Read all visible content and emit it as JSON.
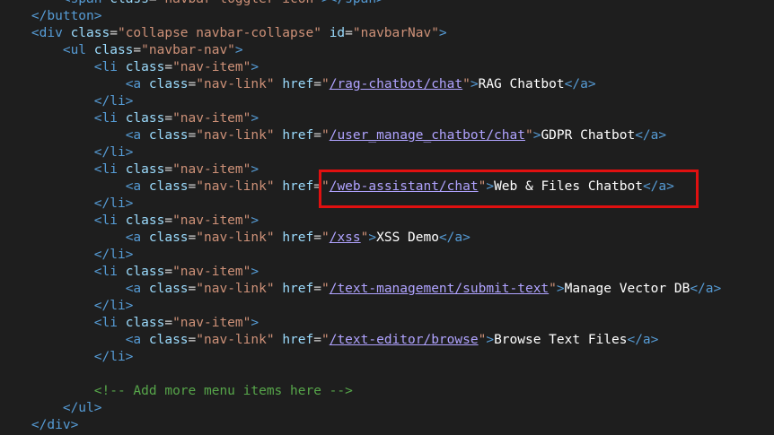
{
  "editor": {
    "highlight_color": "#e01010",
    "colors": {
      "tag": "#569cd6",
      "attr": "#9cdcfe",
      "value": "#ce9178",
      "link": "#b0a3ff",
      "comment": "#57a64a",
      "background": "#1e1e1e"
    },
    "lines": [
      {
        "indent": 8,
        "tokens": [
          {
            "t": "tag",
            "v": "<span "
          },
          {
            "t": "attr",
            "v": "class"
          },
          {
            "t": "punct",
            "v": "="
          },
          {
            "t": "val",
            "v": "\"navbar-toggler-icon\""
          },
          {
            "t": "tag",
            "v": "></span>"
          }
        ]
      },
      {
        "indent": 4,
        "tokens": [
          {
            "t": "tag",
            "v": "</button>"
          }
        ]
      },
      {
        "indent": 4,
        "tokens": [
          {
            "t": "tag",
            "v": "<div "
          },
          {
            "t": "attr",
            "v": "class"
          },
          {
            "t": "punct",
            "v": "="
          },
          {
            "t": "val",
            "v": "\"collapse navbar-collapse\""
          },
          {
            "t": "punct",
            "v": " "
          },
          {
            "t": "attr",
            "v": "id"
          },
          {
            "t": "punct",
            "v": "="
          },
          {
            "t": "val",
            "v": "\"navbarNav\""
          },
          {
            "t": "tag",
            "v": ">"
          }
        ]
      },
      {
        "indent": 8,
        "tokens": [
          {
            "t": "tag",
            "v": "<ul "
          },
          {
            "t": "attr",
            "v": "class"
          },
          {
            "t": "punct",
            "v": "="
          },
          {
            "t": "val",
            "v": "\"navbar-nav\""
          },
          {
            "t": "tag",
            "v": ">"
          }
        ]
      },
      {
        "indent": 12,
        "tokens": [
          {
            "t": "tag",
            "v": "<li "
          },
          {
            "t": "attr",
            "v": "class"
          },
          {
            "t": "punct",
            "v": "="
          },
          {
            "t": "val",
            "v": "\"nav-item\""
          },
          {
            "t": "tag",
            "v": ">"
          }
        ]
      },
      {
        "indent": 16,
        "tokens": [
          {
            "t": "tag",
            "v": "<a "
          },
          {
            "t": "attr",
            "v": "class"
          },
          {
            "t": "punct",
            "v": "="
          },
          {
            "t": "val",
            "v": "\"nav-link\""
          },
          {
            "t": "punct",
            "v": " "
          },
          {
            "t": "attr",
            "v": "href"
          },
          {
            "t": "punct",
            "v": "="
          },
          {
            "t": "val",
            "v": "\""
          },
          {
            "t": "link",
            "v": "/rag-chatbot/chat"
          },
          {
            "t": "val",
            "v": "\""
          },
          {
            "t": "tag",
            "v": ">"
          },
          {
            "t": "text",
            "v": "RAG Chatbot"
          },
          {
            "t": "tag",
            "v": "</a>"
          }
        ]
      },
      {
        "indent": 12,
        "tokens": [
          {
            "t": "tag",
            "v": "</li>"
          }
        ]
      },
      {
        "indent": 12,
        "tokens": [
          {
            "t": "tag",
            "v": "<li "
          },
          {
            "t": "attr",
            "v": "class"
          },
          {
            "t": "punct",
            "v": "="
          },
          {
            "t": "val",
            "v": "\"nav-item\""
          },
          {
            "t": "tag",
            "v": ">"
          }
        ]
      },
      {
        "indent": 16,
        "tokens": [
          {
            "t": "tag",
            "v": "<a "
          },
          {
            "t": "attr",
            "v": "class"
          },
          {
            "t": "punct",
            "v": "="
          },
          {
            "t": "val",
            "v": "\"nav-link\""
          },
          {
            "t": "punct",
            "v": " "
          },
          {
            "t": "attr",
            "v": "href"
          },
          {
            "t": "punct",
            "v": "="
          },
          {
            "t": "val",
            "v": "\""
          },
          {
            "t": "link",
            "v": "/user_manage_chatbot/chat"
          },
          {
            "t": "val",
            "v": "\""
          },
          {
            "t": "tag",
            "v": ">"
          },
          {
            "t": "text",
            "v": "GDPR Chatbot"
          },
          {
            "t": "tag",
            "v": "</a>"
          }
        ]
      },
      {
        "indent": 12,
        "tokens": [
          {
            "t": "tag",
            "v": "</li>"
          }
        ]
      },
      {
        "indent": 12,
        "tokens": [
          {
            "t": "tag",
            "v": "<li "
          },
          {
            "t": "attr",
            "v": "class"
          },
          {
            "t": "punct",
            "v": "="
          },
          {
            "t": "val",
            "v": "\"nav-item\""
          },
          {
            "t": "tag",
            "v": ">"
          }
        ]
      },
      {
        "indent": 16,
        "tokens": [
          {
            "t": "tag",
            "v": "<a "
          },
          {
            "t": "attr",
            "v": "class"
          },
          {
            "t": "punct",
            "v": "="
          },
          {
            "t": "val",
            "v": "\"nav-link\""
          },
          {
            "t": "punct",
            "v": " "
          },
          {
            "t": "attr",
            "v": "href"
          },
          {
            "t": "punct",
            "v": "="
          },
          {
            "t": "val",
            "v": "\""
          },
          {
            "t": "link",
            "v": "/web-assistant/chat"
          },
          {
            "t": "val",
            "v": "\""
          },
          {
            "t": "tag",
            "v": ">"
          },
          {
            "t": "text",
            "v": "Web & Files Chatbot"
          },
          {
            "t": "tag",
            "v": "</a>"
          }
        ]
      },
      {
        "indent": 12,
        "tokens": [
          {
            "t": "tag",
            "v": "</li>"
          }
        ]
      },
      {
        "indent": 12,
        "tokens": [
          {
            "t": "tag",
            "v": "<li "
          },
          {
            "t": "attr",
            "v": "class"
          },
          {
            "t": "punct",
            "v": "="
          },
          {
            "t": "val",
            "v": "\"nav-item\""
          },
          {
            "t": "tag",
            "v": ">"
          }
        ]
      },
      {
        "indent": 16,
        "tokens": [
          {
            "t": "tag",
            "v": "<a "
          },
          {
            "t": "attr",
            "v": "class"
          },
          {
            "t": "punct",
            "v": "="
          },
          {
            "t": "val",
            "v": "\"nav-link\""
          },
          {
            "t": "punct",
            "v": " "
          },
          {
            "t": "attr",
            "v": "href"
          },
          {
            "t": "punct",
            "v": "="
          },
          {
            "t": "val",
            "v": "\""
          },
          {
            "t": "link",
            "v": "/xss"
          },
          {
            "t": "val",
            "v": "\""
          },
          {
            "t": "tag",
            "v": ">"
          },
          {
            "t": "text",
            "v": "XSS Demo"
          },
          {
            "t": "tag",
            "v": "</a>"
          }
        ]
      },
      {
        "indent": 12,
        "tokens": [
          {
            "t": "tag",
            "v": "</li>"
          }
        ]
      },
      {
        "indent": 12,
        "tokens": [
          {
            "t": "tag",
            "v": "<li "
          },
          {
            "t": "attr",
            "v": "class"
          },
          {
            "t": "punct",
            "v": "="
          },
          {
            "t": "val",
            "v": "\"nav-item\""
          },
          {
            "t": "tag",
            "v": ">"
          }
        ]
      },
      {
        "indent": 16,
        "tokens": [
          {
            "t": "tag",
            "v": "<a "
          },
          {
            "t": "attr",
            "v": "class"
          },
          {
            "t": "punct",
            "v": "="
          },
          {
            "t": "val",
            "v": "\"nav-link\""
          },
          {
            "t": "punct",
            "v": " "
          },
          {
            "t": "attr",
            "v": "href"
          },
          {
            "t": "punct",
            "v": "="
          },
          {
            "t": "val",
            "v": "\""
          },
          {
            "t": "link",
            "v": "/text-management/submit-text"
          },
          {
            "t": "val",
            "v": "\""
          },
          {
            "t": "tag",
            "v": ">"
          },
          {
            "t": "text",
            "v": "Manage Vector DB"
          },
          {
            "t": "tag",
            "v": "</a>"
          }
        ]
      },
      {
        "indent": 12,
        "tokens": [
          {
            "t": "tag",
            "v": "</li>"
          }
        ]
      },
      {
        "indent": 12,
        "tokens": [
          {
            "t": "tag",
            "v": "<li "
          },
          {
            "t": "attr",
            "v": "class"
          },
          {
            "t": "punct",
            "v": "="
          },
          {
            "t": "val",
            "v": "\"nav-item\""
          },
          {
            "t": "tag",
            "v": ">"
          }
        ]
      },
      {
        "indent": 16,
        "tokens": [
          {
            "t": "tag",
            "v": "<a "
          },
          {
            "t": "attr",
            "v": "class"
          },
          {
            "t": "punct",
            "v": "="
          },
          {
            "t": "val",
            "v": "\"nav-link\""
          },
          {
            "t": "punct",
            "v": " "
          },
          {
            "t": "attr",
            "v": "href"
          },
          {
            "t": "punct",
            "v": "="
          },
          {
            "t": "val",
            "v": "\""
          },
          {
            "t": "link",
            "v": "/text-editor/browse"
          },
          {
            "t": "val",
            "v": "\""
          },
          {
            "t": "tag",
            "v": ">"
          },
          {
            "t": "text",
            "v": "Browse Text Files"
          },
          {
            "t": "tag",
            "v": "</a>"
          }
        ]
      },
      {
        "indent": 12,
        "tokens": [
          {
            "t": "tag",
            "v": "</li>"
          }
        ]
      },
      {
        "indent": 0,
        "tokens": []
      },
      {
        "indent": 12,
        "tokens": [
          {
            "t": "comment",
            "v": "<!-- Add more menu items here -->"
          }
        ]
      },
      {
        "indent": 8,
        "tokens": [
          {
            "t": "tag",
            "v": "</ul>"
          }
        ]
      },
      {
        "indent": 4,
        "tokens": [
          {
            "t": "tag",
            "v": "</div>"
          }
        ]
      }
    ]
  }
}
